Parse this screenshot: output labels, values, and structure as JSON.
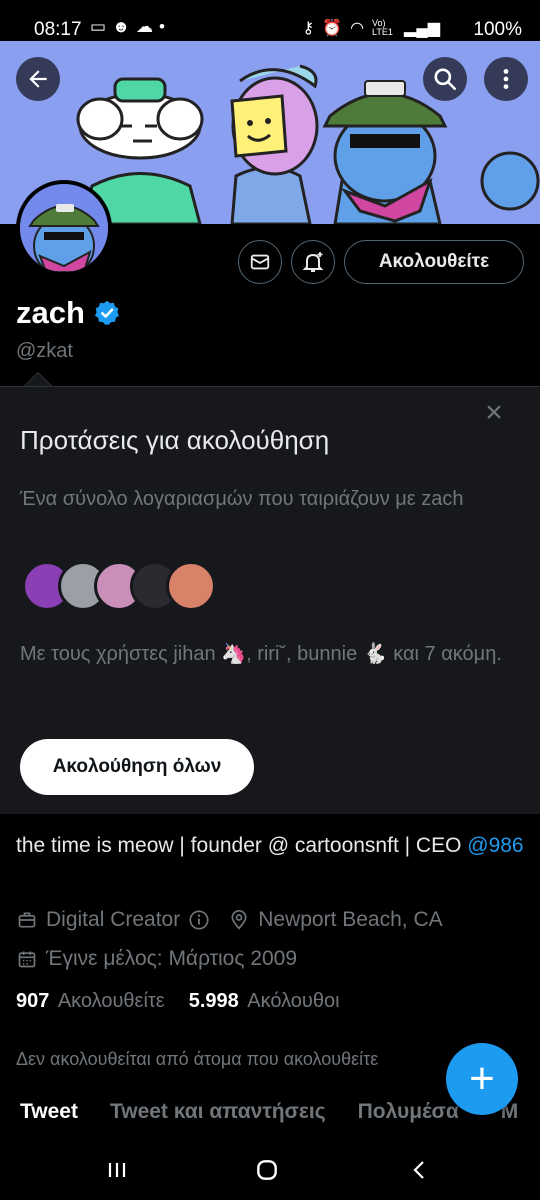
{
  "status_bar": {
    "time": "08:17",
    "left_icons": [
      "screen-icon",
      "face-icon",
      "cloud-icon",
      "dot-icon"
    ],
    "right_icons": [
      "key-icon",
      "alarm-icon",
      "wifi-icon",
      "volte-icon",
      "signal-icon"
    ],
    "volte_label": "Vo) LTE1",
    "battery": "100%"
  },
  "header": {
    "back_icon": "arrow-left-icon",
    "search_icon": "search-icon",
    "more_icon": "more-vertical-icon"
  },
  "profile": {
    "name": "zach",
    "handle": "@zkat",
    "follow_button": "Ακολουθείτε",
    "bio_text": "the time is meow | founder @ cartoonsnft | CEO ",
    "bio_mention": "@986",
    "category": "Digital Creator",
    "location": "Newport Beach, CA",
    "joined": "Έγινε μέλος: Μάρτιος 2009",
    "following_count": "907",
    "following_label": "Ακολουθείτε",
    "followers_count": "5.998",
    "followers_label": "Ακόλουθοι",
    "not_followed_text": "Δεν ακολουθείται από άτομα που ακολουθείτε"
  },
  "suggestions": {
    "title": "Προτάσεις για ακολούθηση",
    "subtitle": "Ένα σύνολο λογαριασμών που ταιριάζουν με zach",
    "names_text": "Με τους χρήστες jihan 🦄, riri˘, bunnie 🐇 και 7 ακόμη.",
    "follow_all_button": "Ακολούθηση όλων",
    "avatar_colors": [
      "#8a3fb5",
      "#9aa0a6",
      "#c98fb8",
      "#2a2a30",
      "#d9826a"
    ]
  },
  "tabs": [
    {
      "label": "Tweet"
    },
    {
      "label": "Tweet και απαντήσεις"
    },
    {
      "label": "Πολυμέσα"
    },
    {
      "label": "\"Μ"
    }
  ],
  "fab_label": "+",
  "colors": {
    "accent": "#1d9bf0",
    "banner": "#8da0ee",
    "background": "#000000",
    "card": "#16181c"
  }
}
